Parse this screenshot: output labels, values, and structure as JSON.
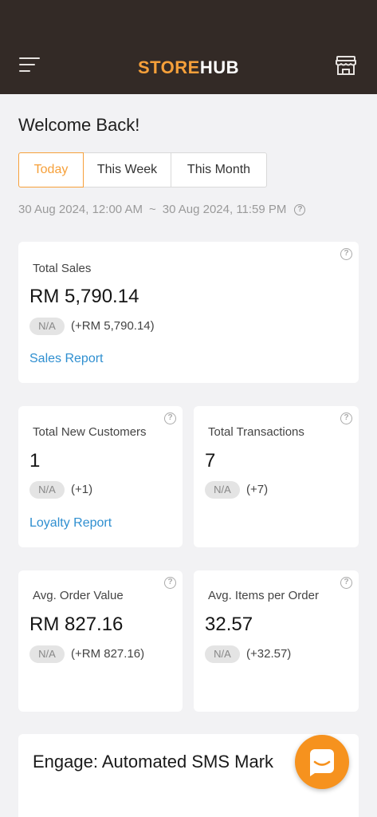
{
  "header": {
    "logo_part1": "STORE",
    "logo_part2": "HUB",
    "menu_icon": "hamburger-menu-icon",
    "store_icon": "storefront-icon"
  },
  "welcome": "Welcome Back!",
  "tabs": [
    {
      "label": "Today",
      "selected": true
    },
    {
      "label": "This Week",
      "selected": false
    },
    {
      "label": "This Month",
      "selected": false
    }
  ],
  "date_range": {
    "start": "30 Aug 2024, 12:00 AM",
    "separator": "~",
    "end": "30 Aug 2024, 11:59 PM"
  },
  "cards": {
    "total_sales": {
      "label": "Total Sales",
      "value": "RM 5,790.14",
      "badge": "N/A",
      "change": "(+RM 5,790.14)",
      "link": "Sales Report"
    },
    "new_customers": {
      "label": "Total New Customers",
      "value": "1",
      "badge": "N/A",
      "change": "(+1)",
      "link": "Loyalty Report"
    },
    "transactions": {
      "label": "Total Transactions",
      "value": "7",
      "badge": "N/A",
      "change": "(+7)"
    },
    "avg_order": {
      "label": "Avg. Order Value",
      "value": "RM 827.16",
      "badge": "N/A",
      "change": "(+RM 827.16)"
    },
    "avg_items": {
      "label": "Avg. Items per Order",
      "value": "32.57",
      "badge": "N/A",
      "change": "(+32.57)"
    },
    "engage": {
      "title": "Engage: Automated SMS Mark"
    }
  },
  "colors": {
    "header_bg": "#332a26",
    "accent_orange": "#f6a03a",
    "link_blue": "#2f8fd0",
    "fab_orange": "#f6921e"
  }
}
